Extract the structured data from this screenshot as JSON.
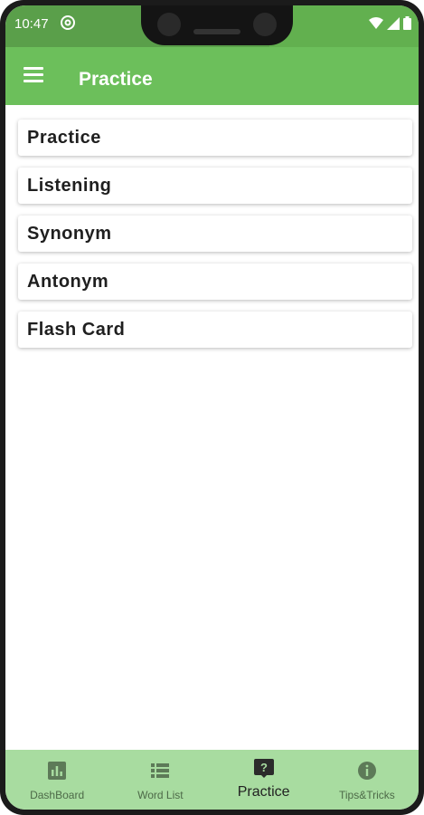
{
  "status_bar": {
    "time": "10:47"
  },
  "app_bar": {
    "title": "Practice"
  },
  "practice_items": [
    "Practice",
    "Listening",
    "Synonym",
    "Antonym",
    "Flash Card"
  ],
  "bottom_nav": {
    "items": [
      {
        "label": "DashBoard",
        "icon": "bar-chart-icon"
      },
      {
        "label": "Word List",
        "icon": "list-icon"
      },
      {
        "label": "Practice",
        "icon": "question-icon",
        "active": true
      },
      {
        "label": "Tips&Tricks",
        "icon": "info-icon"
      }
    ]
  },
  "colors": {
    "app_bar": "#6cbf5b",
    "status_bar": "#5a9f4a",
    "bottom_nav": "#a8dca0"
  }
}
